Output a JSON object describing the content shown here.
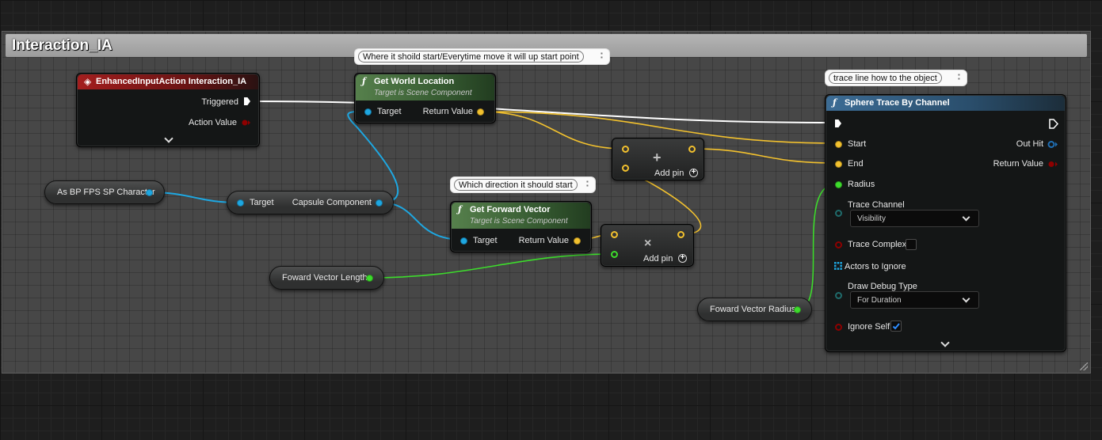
{
  "comment_box": {
    "title": "Interaction_IA"
  },
  "comments": {
    "world_location": "Where it shoild start/Everytime move it will up start point",
    "forward_vector": "Which direction it should start",
    "trace": "trace  line  how to the object"
  },
  "nodes": {
    "enhanced_input": {
      "title": "EnhancedInputAction Interaction_IA",
      "pins": {
        "triggered": "Triggered",
        "action_value": "Action Value"
      }
    },
    "get_world_location": {
      "title": "Get World Location",
      "subtitle": "Target is Scene Component",
      "pins": {
        "target": "Target",
        "return_value": "Return Value"
      }
    },
    "as_bp_fps": {
      "label": "As BP FPS SP Character"
    },
    "capsule_component": {
      "pins": {
        "target": "Target",
        "capsule": "Capsule Component"
      }
    },
    "get_forward_vector": {
      "title": "Get Forward Vector",
      "subtitle": "Target is Scene Component",
      "pins": {
        "target": "Target",
        "return_value": "Return Value"
      }
    },
    "add_top": {
      "op": "+",
      "add_pin": "Add pin"
    },
    "mult": {
      "op": "×",
      "add_pin": "Add pin"
    },
    "forward_vector_length": {
      "label": "Foward Vector Length"
    },
    "forward_vector_radius": {
      "label": "Foward Vector Radius"
    },
    "sphere_trace": {
      "title": "Sphere Trace By Channel",
      "pins": {
        "start": "Start",
        "end": "End",
        "radius": "Radius",
        "trace_channel": "Trace Channel",
        "trace_complex": "Trace Complex",
        "actors_to_ignore": "Actors to Ignore",
        "draw_debug_type": "Draw Debug Type",
        "ignore_self": "Ignore Self",
        "out_hit": "Out Hit",
        "return_value": "Return Value"
      },
      "trace_channel_value": "Visibility",
      "draw_debug_value": "For Duration",
      "trace_complex_checked": false,
      "ignore_self_checked": true
    }
  },
  "colors": {
    "exec": "#ffffff",
    "vector": "#f2c12e",
    "object": "#1ea7e1",
    "float": "#3ddc2c",
    "bool": "#8e0000",
    "struct": "#1f6fb5",
    "enum": "#1f6b6b",
    "event_header": "#9b1b1b",
    "pure_header": "#4d7a46",
    "call_header": "#2e5d80"
  }
}
